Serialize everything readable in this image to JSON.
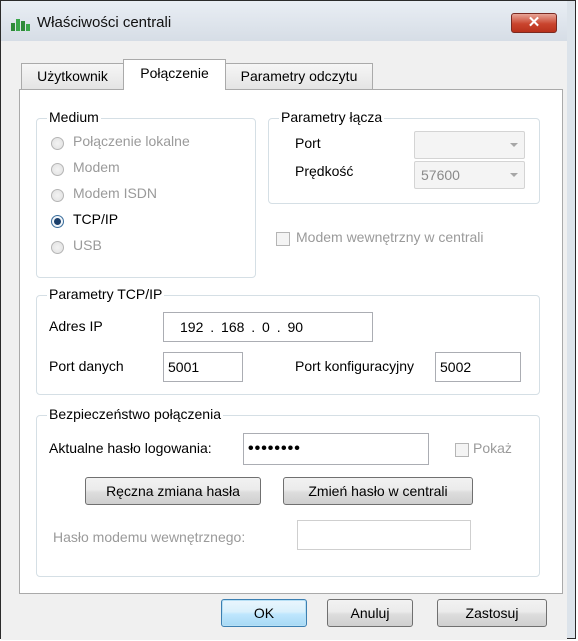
{
  "window": {
    "title": "Właściwości centrali"
  },
  "tabs": [
    {
      "label": "Użytkownik"
    },
    {
      "label": "Połączenie"
    },
    {
      "label": "Parametry odczytu"
    }
  ],
  "medium": {
    "legend": "Medium",
    "options": [
      {
        "label": "Połączenie lokalne",
        "enabled": false,
        "selected": false
      },
      {
        "label": "Modem",
        "enabled": false,
        "selected": false
      },
      {
        "label": "Modem ISDN",
        "enabled": false,
        "selected": false
      },
      {
        "label": "TCP/IP",
        "enabled": true,
        "selected": true
      },
      {
        "label": "USB",
        "enabled": false,
        "selected": false
      }
    ]
  },
  "link_params": {
    "legend": "Parametry łącza",
    "port_label": "Port",
    "port_value": "",
    "speed_label": "Prędkość",
    "speed_value": "57600"
  },
  "internal_modem": {
    "label": "Modem wewnętrzny w centrali",
    "checked": false
  },
  "tcpip": {
    "legend": "Parametry TCP/IP",
    "ip_label": "Adres IP",
    "ip_value": "192 . 168 . 0 . 90",
    "data_port_label": "Port danych",
    "data_port_value": "5001",
    "config_port_label": "Port konfiguracyjny",
    "config_port_value": "5002"
  },
  "security": {
    "legend": "Bezpieczeństwo połączenia",
    "password_label": "Aktualne hasło logowania:",
    "password_value": "••••••••",
    "show_label": "Pokaż",
    "manual_change_label": "Ręczna zmiana hasła",
    "change_in_panel_label": "Zmień hasło w centrali",
    "modem_password_label": "Hasło modemu wewnętrznego:",
    "modem_password_value": ""
  },
  "buttons": {
    "ok": "OK",
    "cancel": "Anuluj",
    "apply": "Zastosuj"
  }
}
